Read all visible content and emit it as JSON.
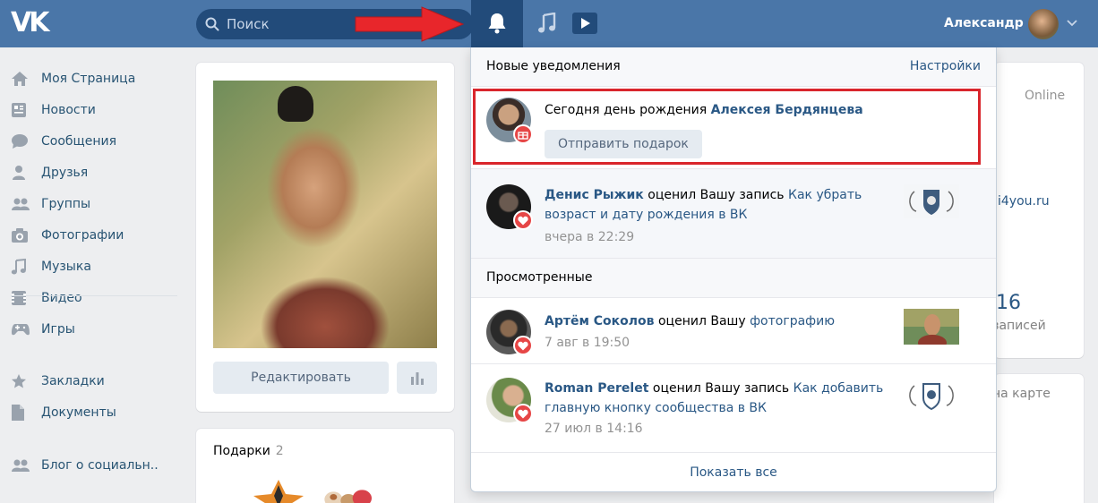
{
  "header": {
    "logo": "VK",
    "search_placeholder": "Поиск",
    "user_name": "Александр"
  },
  "sidebar": {
    "items": [
      {
        "label": "Моя Страница",
        "icon": "home-icon"
      },
      {
        "label": "Новости",
        "icon": "news-icon"
      },
      {
        "label": "Сообщения",
        "icon": "messages-icon"
      },
      {
        "label": "Друзья",
        "icon": "friends-icon"
      },
      {
        "label": "Группы",
        "icon": "groups-icon"
      },
      {
        "label": "Фотографии",
        "icon": "camera-icon"
      },
      {
        "label": "Музыка",
        "icon": "music-icon"
      },
      {
        "label": "Видео",
        "icon": "video-icon"
      },
      {
        "label": "Игры",
        "icon": "gamepad-icon"
      },
      {
        "label": "Закладки",
        "icon": "star-icon"
      },
      {
        "label": "Документы",
        "icon": "document-icon"
      },
      {
        "label": "Блог о социальн..",
        "icon": "community-icon"
      }
    ]
  },
  "profile": {
    "edit_label": "Редактировать",
    "gifts_title": "Подарки",
    "gifts_count": "2"
  },
  "background": {
    "online": "Online",
    "site": "i4you.ru",
    "posts_number": "16",
    "posts_label": "записей",
    "map_label": "на карте"
  },
  "notifications": {
    "new_title": "Новые уведомления",
    "settings_label": "Настройки",
    "birthday": {
      "text": "Сегодня день рождения ",
      "name": "Алексея Бердянцева",
      "button": "Отправить подарок"
    },
    "new_items": [
      {
        "name": "Денис Рыжик",
        "action": " оценил Вашу запись ",
        "link_line1": "Как убрать",
        "link_line2": "возраст и дату рождения в ВК",
        "time": "вчера в 22:29"
      }
    ],
    "viewed_title": "Просмотренные",
    "viewed_items": [
      {
        "name": "Артём Соколов",
        "action": " оценил Вашу ",
        "link": "фотографию",
        "time": "7 авг в 19:50"
      },
      {
        "name": "Roman Perelet",
        "action": " оценил Вашу запись ",
        "link_line1": "Как добавить",
        "link_line2": "главную кнопку сообщества в ВК",
        "time": "27 июл в 14:16"
      }
    ],
    "show_all": "Показать все"
  },
  "colors": {
    "header": "#4a76a8",
    "link": "#2a5885",
    "badge": "#e64646",
    "highlight_box": "#d9262c",
    "arrow": "#e8262b"
  }
}
